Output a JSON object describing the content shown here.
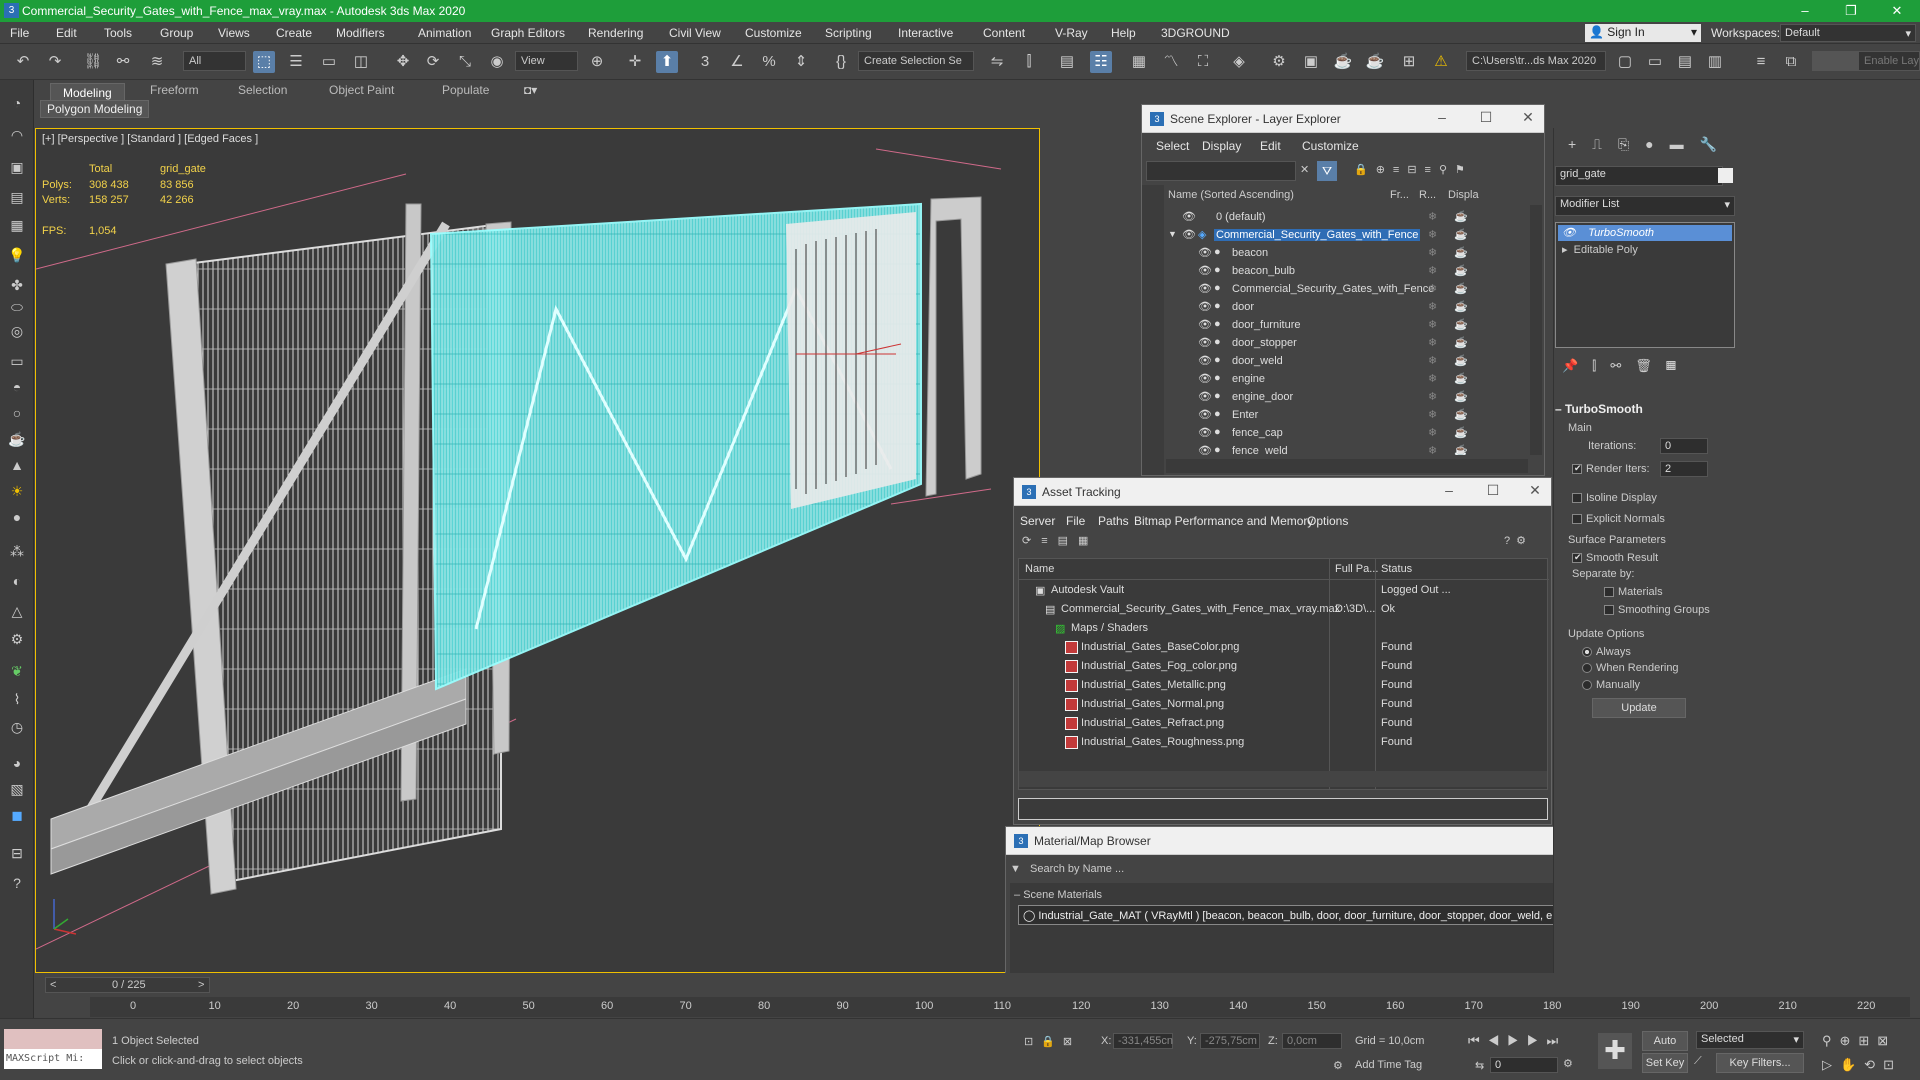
{
  "app": {
    "title": "Commercial_Security_Gates_with_Fence_max_vray.max - Autodesk 3ds Max 2020",
    "icon": "3"
  },
  "menu": [
    "File",
    "Edit",
    "Tools",
    "Group",
    "Views",
    "Create",
    "Modifiers",
    "Animation",
    "Graph Editors",
    "Rendering",
    "Civil View",
    "Customize",
    "Scripting",
    "Interactive",
    "Content",
    "V-Ray",
    "Help",
    "3DGROUND"
  ],
  "account": {
    "sign_in": "Sign In",
    "workspaces_label": "Workspaces:",
    "workspace": "Default"
  },
  "toolbar": {
    "filter": "All",
    "view": "View",
    "selection_set": "Create Selection Se",
    "path": "C:\\Users\\tr...ds Max 2020",
    "enable_label": "Enable Laye"
  },
  "ribbon": {
    "tabs": [
      "Modeling",
      "Freeform",
      "Selection",
      "Object Paint",
      "Populate"
    ],
    "sub": "Polygon Modeling"
  },
  "viewport": {
    "label": "[+] [Perspective ] [Standard ] [Edged Faces ]",
    "stats_head": "Total",
    "stats_obj": "grid_gate",
    "polys_label": "Polys:",
    "polys_total": "308 438",
    "polys_obj": "83 856",
    "verts_label": "Verts:",
    "verts_total": "158 257",
    "verts_obj": "42 266",
    "fps_label": "FPS:",
    "fps": "1,054"
  },
  "scene_explorer": {
    "title": "Scene Explorer - Layer Explorer",
    "menu": [
      "Select",
      "Display",
      "Edit",
      "Customize"
    ],
    "col_name": "Name (Sorted Ascending)",
    "col_fr": "Fr...",
    "col_r": "R...",
    "col_disp": "Displa",
    "rows": [
      {
        "name": "0 (default)",
        "level": 0
      },
      {
        "name": "Commercial_Security_Gates_with_Fence",
        "level": 0,
        "selected": true
      },
      {
        "name": "beacon",
        "level": 1
      },
      {
        "name": "beacon_bulb",
        "level": 1
      },
      {
        "name": "Commercial_Security_Gates_with_Fence",
        "level": 1
      },
      {
        "name": "door",
        "level": 1
      },
      {
        "name": "door_furniture",
        "level": 1
      },
      {
        "name": "door_stopper",
        "level": 1
      },
      {
        "name": "door_weld",
        "level": 1
      },
      {
        "name": "engine",
        "level": 1
      },
      {
        "name": "engine_door",
        "level": 1
      },
      {
        "name": "Enter",
        "level": 1
      },
      {
        "name": "fence_cap",
        "level": 1
      },
      {
        "name": "fence_weld",
        "level": 1
      }
    ]
  },
  "asset_tracking": {
    "title": "Asset Tracking",
    "menu": [
      "Server",
      "File",
      "Paths",
      "Bitmap Performance and Memory",
      "Options"
    ],
    "col_name": "Name",
    "col_path": "Full Pa...",
    "col_status": "Status",
    "rows": [
      {
        "name": "Autodesk Vault",
        "path": "",
        "status": "Logged Out ...",
        "indent": 1
      },
      {
        "name": "Commercial_Security_Gates_with_Fence_max_vray.max",
        "path": "D:\\3D\\...",
        "status": "Ok",
        "indent": 2
      },
      {
        "name": "Maps / Shaders",
        "path": "",
        "status": "",
        "indent": 3
      },
      {
        "name": "Industrial_Gates_BaseColor.png",
        "path": "",
        "status": "Found",
        "indent": 4
      },
      {
        "name": "Industrial_Gates_Fog_color.png",
        "path": "",
        "status": "Found",
        "indent": 4
      },
      {
        "name": "Industrial_Gates_Metallic.png",
        "path": "",
        "status": "Found",
        "indent": 4
      },
      {
        "name": "Industrial_Gates_Normal.png",
        "path": "",
        "status": "Found",
        "indent": 4
      },
      {
        "name": "Industrial_Gates_Refract.png",
        "path": "",
        "status": "Found",
        "indent": 4
      },
      {
        "name": "Industrial_Gates_Roughness.png",
        "path": "",
        "status": "Found",
        "indent": 4
      }
    ]
  },
  "material_browser": {
    "title": "Material/Map Browser",
    "search": "Search by Name ...",
    "section": "Scene Materials",
    "item": "Industrial_Gate_MAT ( VRayMtl ) [beacon, beacon_bulb, door, door_furniture, door_stopper, door_weld, engine, engine_door, fence_cap, fence_weld, gate,..."
  },
  "modify": {
    "object_name": "grid_gate",
    "modifier_list": "Modifier List",
    "stack": [
      "TurboSmooth",
      "Editable Poly"
    ],
    "rollout": "TurboSmooth",
    "main": "Main",
    "iterations_label": "Iterations:",
    "iterations": "0",
    "render_iters_label": "Render Iters:",
    "render_iters": "2",
    "isoline": "Isoline Display",
    "explicit": "Explicit Normals",
    "surface": "Surface Parameters",
    "smooth_result": "Smooth Result",
    "separate": "Separate by:",
    "materials": "Materials",
    "smoothing": "Smoothing Groups",
    "update_options": "Update Options",
    "always": "Always",
    "when_rendering": "When Rendering",
    "manually": "Manually",
    "update": "Update"
  },
  "timeline": {
    "frame": "0 / 225",
    "ticks": [
      "0",
      "10",
      "20",
      "30",
      "40",
      "50",
      "60",
      "70",
      "80",
      "90",
      "100",
      "110",
      "120",
      "130",
      "140",
      "150",
      "160",
      "170",
      "180",
      "190",
      "200",
      "210",
      "220"
    ]
  },
  "status": {
    "maxscript": "MAXScript Mi:",
    "selected": "1 Object Selected",
    "hint": "Click or click-and-drag to select objects",
    "x_label": "X:",
    "x": "-331,455cn",
    "y_label": "Y:",
    "y": "-275,75cm",
    "z_label": "Z:",
    "z": "0,0cm",
    "grid": "Grid = 10,0cm",
    "add_time_tag": "Add Time Tag",
    "auto_key": "Auto Key",
    "set_key": "Set Key",
    "selected_dd": "Selected",
    "key_filters": "Key Filters...",
    "frame_field": "0"
  }
}
